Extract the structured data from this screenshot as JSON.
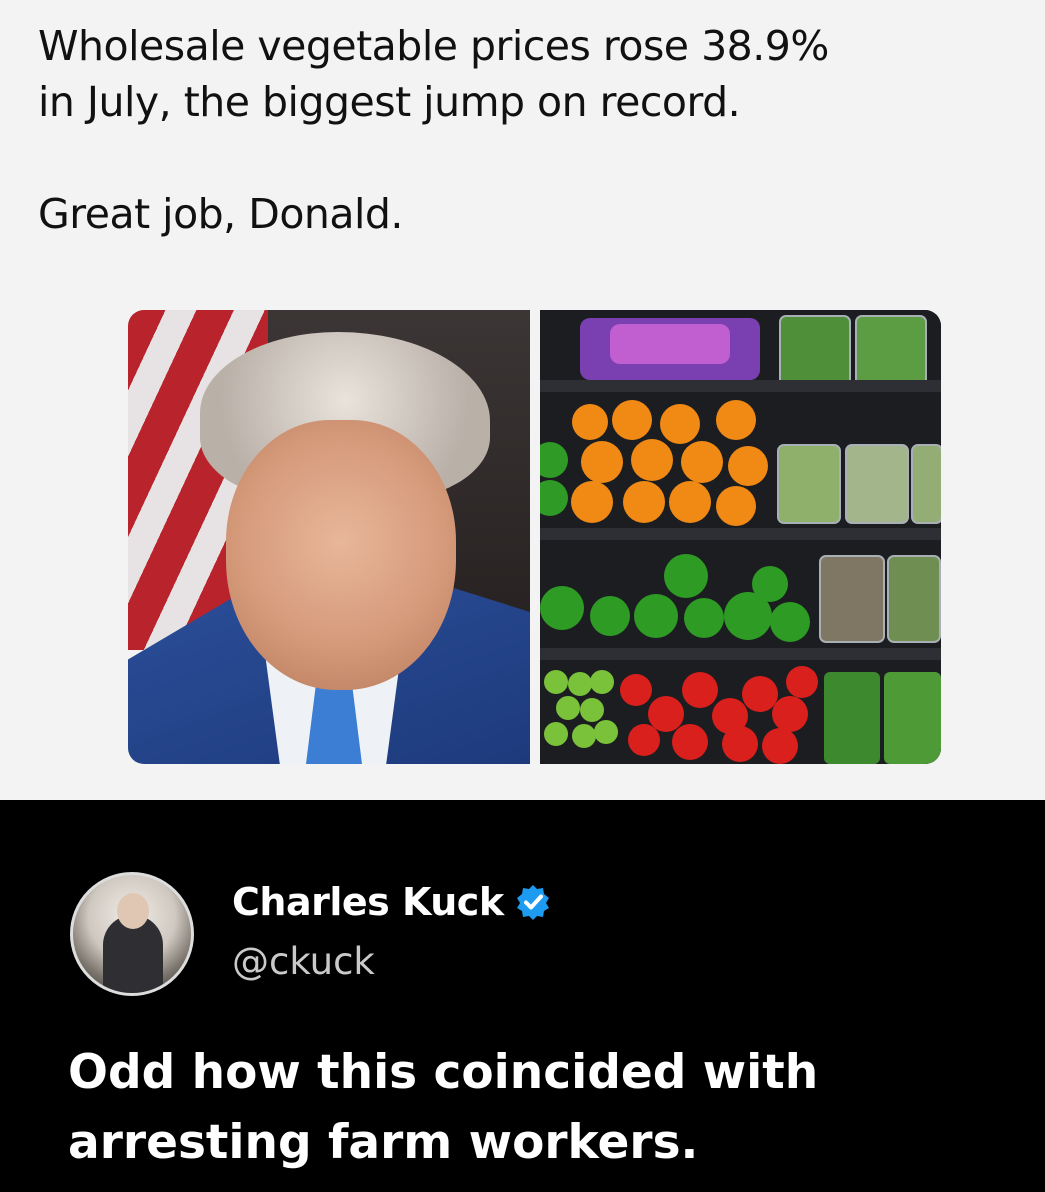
{
  "post": {
    "line1": "Wholesale vegetable prices rose 38.9%",
    "line2": "in July, the biggest jump on record.",
    "line3": "Great job, Donald."
  },
  "reply": {
    "display_name": "Charles Kuck",
    "handle": "@ckuck",
    "verified": true,
    "text_line1": "Odd how this coincided with",
    "text_line2": "arresting farm workers."
  },
  "colors": {
    "top_background": "#f3f3f3",
    "bottom_background": "#000000",
    "verified_badge": "#1d9bf0"
  }
}
